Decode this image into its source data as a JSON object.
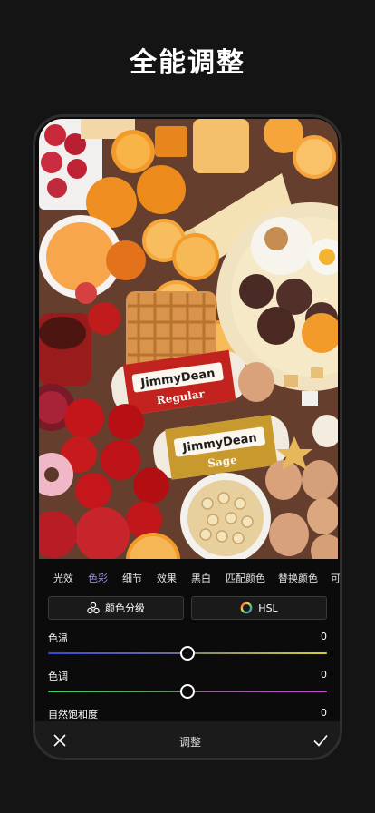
{
  "headline": "全能调整",
  "photo": {
    "package_brand": "JimmyDean",
    "package_variant_1": "Regular",
    "package_variant_2": "Sage"
  },
  "tabs": [
    {
      "label": "光效",
      "active": false
    },
    {
      "label": "色彩",
      "active": true
    },
    {
      "label": "细节",
      "active": false
    },
    {
      "label": "效果",
      "active": false
    },
    {
      "label": "黑白",
      "active": false
    },
    {
      "label": "匹配颜色",
      "active": false
    },
    {
      "label": "替换颜色",
      "active": false
    },
    {
      "label": "可",
      "active": false
    }
  ],
  "buttons": {
    "color_grading": "颜色分级",
    "hsl": "HSL"
  },
  "sliders": [
    {
      "label": "色温",
      "value": "0",
      "fraction": 0.5
    },
    {
      "label": "色调",
      "value": "0",
      "fraction": 0.5
    },
    {
      "label": "自然饱和度",
      "value": "0",
      "fraction": 0.5
    }
  ],
  "bottom": {
    "title": "调整",
    "close_icon": "close-icon",
    "confirm_icon": "check-icon"
  },
  "colors": {
    "accent": "#9c8cff",
    "background": "#141414"
  }
}
